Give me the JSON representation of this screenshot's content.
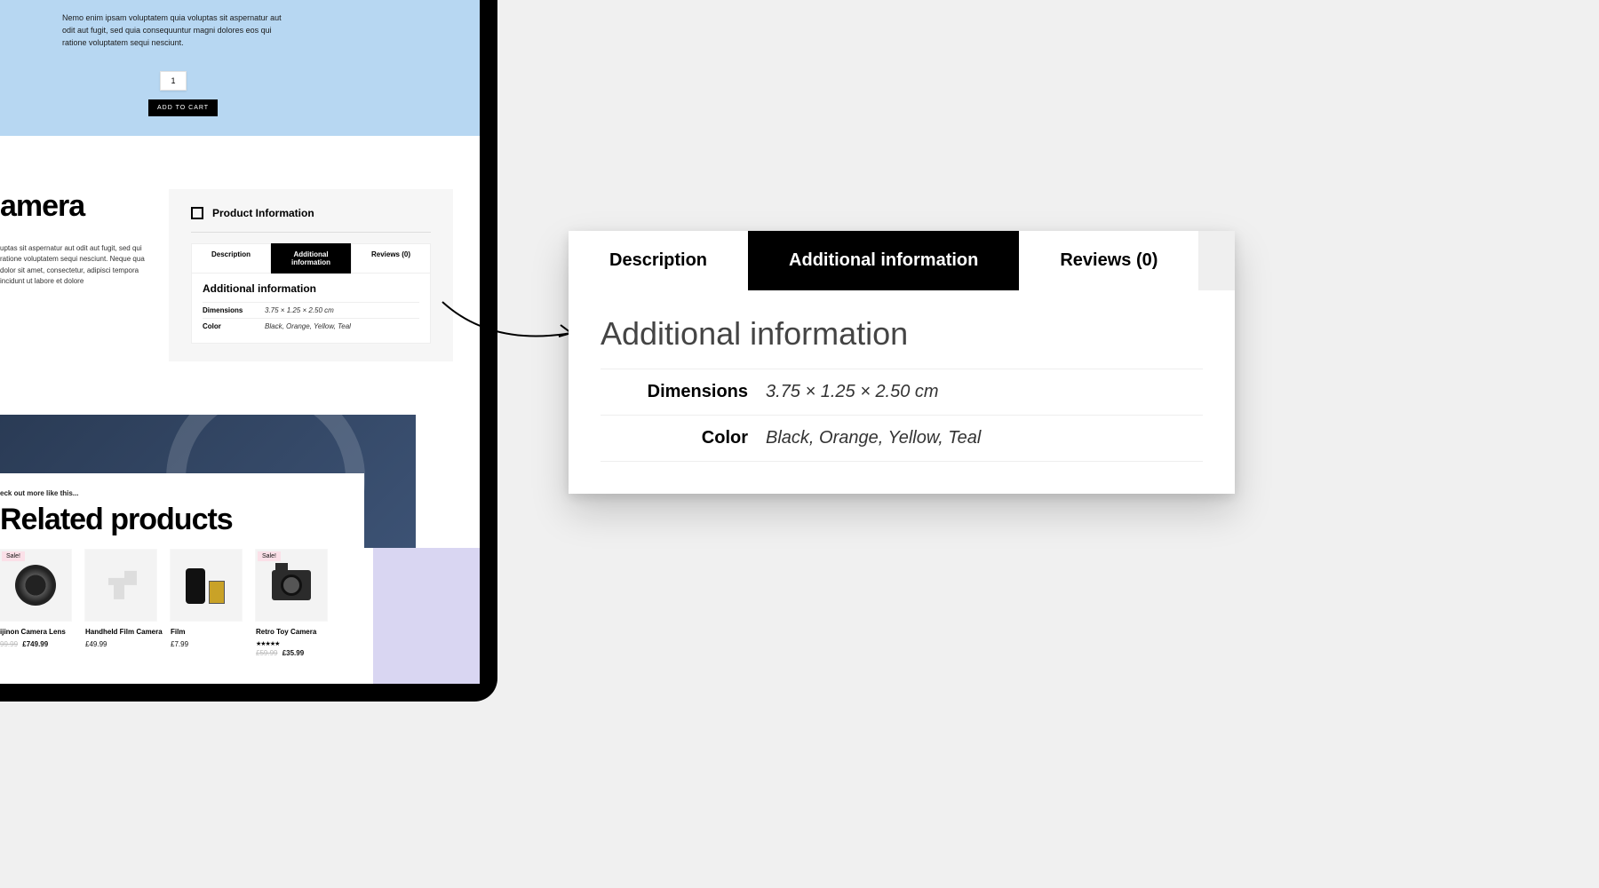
{
  "hero": {
    "blurb": "Nemo enim ipsam voluptatem quia voluptas sit aspernatur aut odit aut fugit, sed quia consequuntur magni dolores eos qui ratione voluptatem sequi nesciunt.",
    "qty": "1",
    "add_to_cart": "ADD TO CART"
  },
  "product": {
    "title_fragment": "amera",
    "desc": "uptas sit aspernatur aut odit aut fugit, sed qui ratione voluptatem sequi nesciunt. Neque qua dolor sit amet, consectetur, adipisci tempora incidunt ut labore et dolore"
  },
  "info_box": {
    "heading": "Product Information",
    "tabs": [
      "Description",
      "Additional information",
      "Reviews (0)"
    ],
    "active": 1,
    "panel_title": "Additional information",
    "rows": [
      {
        "label": "Dimensions",
        "value": "3.75 × 1.25 × 2.50 cm"
      },
      {
        "label": "Color",
        "value": "Black, Orange, Yellow, Teal"
      }
    ]
  },
  "related": {
    "kicker": "eck out more like this...",
    "heading": "Related products",
    "sale_label": "Sale!",
    "items": [
      {
        "name": "ijinon Camera Lens",
        "sale": true,
        "old_price": "99.99",
        "price": "£749.99"
      },
      {
        "name": "Handheld Film Camera",
        "sale": false,
        "price": "£49.99"
      },
      {
        "name": "Film",
        "sale": false,
        "price": "£7.99"
      },
      {
        "name": "Retro Toy Camera",
        "sale": true,
        "stars": "★★★★★",
        "old_price": "£59.99",
        "price": "£35.99"
      }
    ]
  },
  "zoom": {
    "tabs": [
      "Description",
      "Additional information",
      "Reviews (0)"
    ],
    "active": 1,
    "heading": "Additional information",
    "rows": [
      {
        "label": "Dimensions",
        "value": "3.75 × 1.25 × 2.50 cm"
      },
      {
        "label": "Color",
        "value": "Black, Orange, Yellow, Teal"
      }
    ]
  }
}
